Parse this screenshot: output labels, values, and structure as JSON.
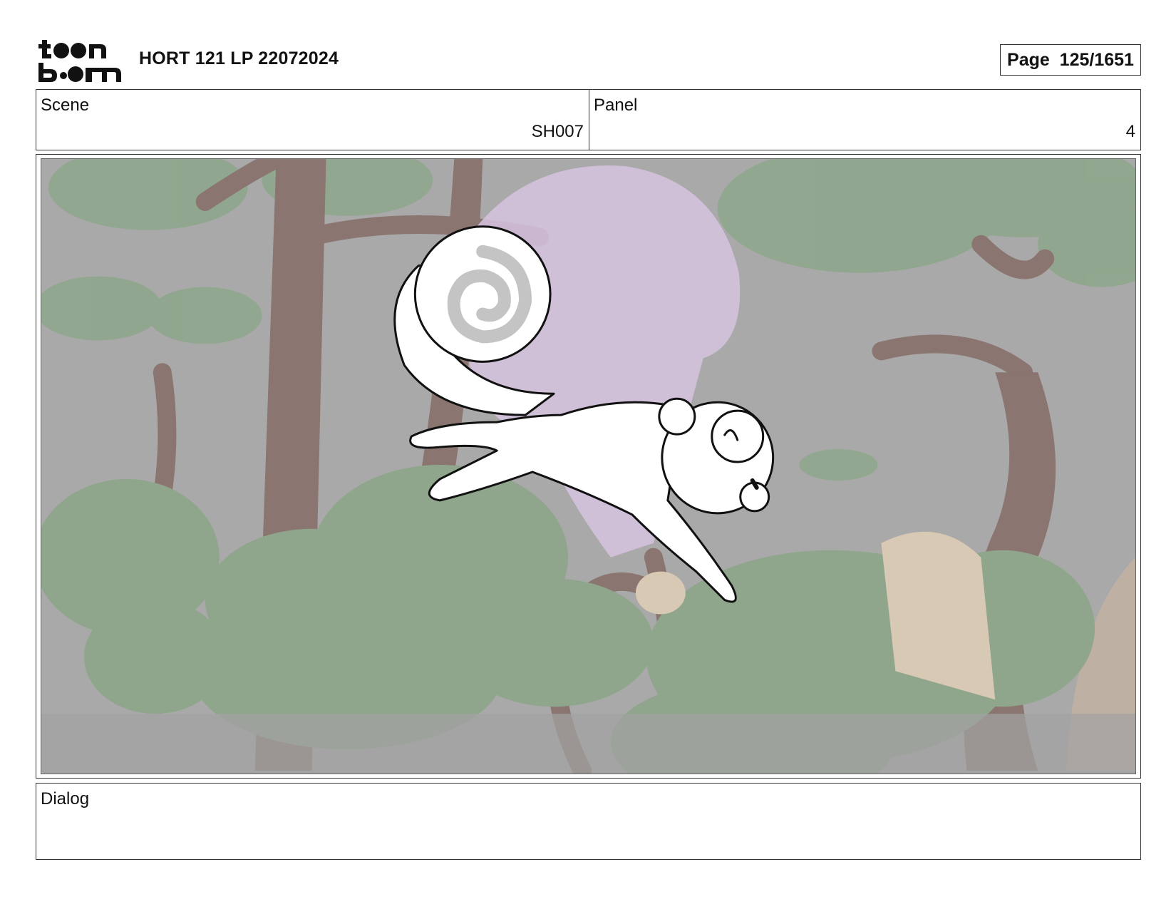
{
  "header": {
    "logo_top": "t●●n",
    "logo_bottom": "b●●m",
    "title": "HORT 121 LP 22072024",
    "page_label": "Page  125/1651"
  },
  "scene": {
    "label": "Scene",
    "value": "SH007"
  },
  "panel": {
    "label": "Panel",
    "value": "4"
  },
  "dialog": {
    "label": "Dialog",
    "value": ""
  },
  "artwork": {
    "background_color": "#a8a8a8",
    "foliage_color": "#8fa68c",
    "trunk_color": "#8a7570",
    "rock_color": "#d6c4e0",
    "character_fill": "#ffffff",
    "character_line": "#111111"
  }
}
